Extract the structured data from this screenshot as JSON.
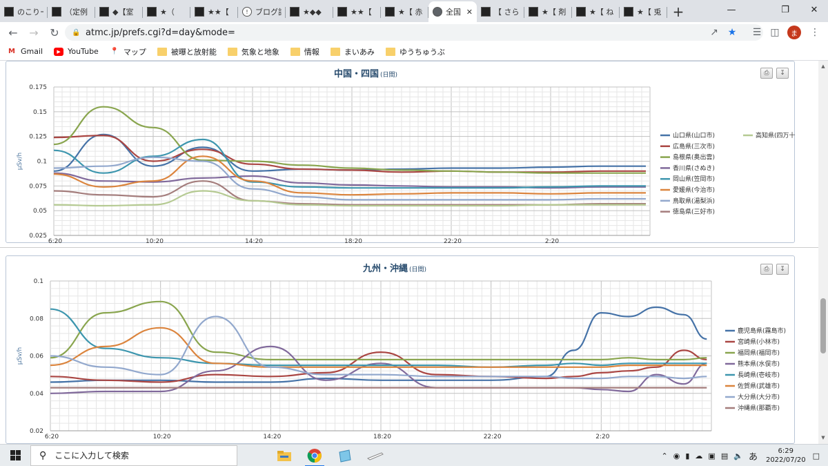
{
  "browser": {
    "tabs": [
      {
        "label": "のこりー",
        "icon": "site-icon",
        "active": false
      },
      {
        "label": "（定例",
        "icon": "site-icon",
        "active": false
      },
      {
        "label": "◆【室",
        "icon": "site-icon",
        "active": false
      },
      {
        "label": "★（",
        "icon": "site-icon",
        "active": false
      },
      {
        "label": "★★【",
        "icon": "site-icon",
        "active": false
      },
      {
        "label": "ブログ記",
        "icon": "blog-icon",
        "active": false
      },
      {
        "label": "★◆◆",
        "icon": "site-icon",
        "active": false
      },
      {
        "label": "★★【",
        "icon": "site-icon",
        "active": false
      },
      {
        "label": "★【 赤",
        "icon": "site-icon",
        "active": false
      },
      {
        "label": "全国",
        "icon": "globe-icon",
        "active": true
      },
      {
        "label": "【 さら",
        "icon": "site-icon",
        "active": false
      },
      {
        "label": "★【 剤",
        "icon": "site-icon",
        "active": false
      },
      {
        "label": "★【 ね",
        "icon": "site-icon",
        "active": false
      },
      {
        "label": "★【 兎",
        "icon": "site-icon",
        "active": false
      }
    ],
    "url": "atmc.jp/prefs.cgi?d=day&mode=",
    "avatar_initial": "ま",
    "bookmarks": [
      {
        "label": "Gmail",
        "icon": "gmail-icon"
      },
      {
        "label": "YouTube",
        "icon": "youtube-icon"
      },
      {
        "label": "マップ",
        "icon": "maps-icon"
      },
      {
        "label": "被曝と放射能",
        "icon": "folder-icon"
      },
      {
        "label": "気象と地象",
        "icon": "folder-icon"
      },
      {
        "label": "情報",
        "icon": "folder-icon"
      },
      {
        "label": "まいあみ",
        "icon": "folder-icon"
      },
      {
        "label": "ゆうちゅうぶ",
        "icon": "folder-icon"
      }
    ]
  },
  "taskbar": {
    "search_placeholder": "ここに入力して検索",
    "time": "6:29",
    "date": "2022/07/20",
    "ime": "あ"
  },
  "chart_data": [
    {
      "type": "line",
      "title": "中国・四国",
      "subtitle": "(日間)",
      "ylabel": "μSv/h",
      "ylim": [
        0.025,
        0.175
      ],
      "yticks": [
        "0.175",
        "0.15",
        "0.125",
        "0.1",
        "0.075",
        "0.05",
        "0.025"
      ],
      "xticks": [
        "6:20",
        "10:20",
        "14:20",
        "18:20",
        "22:20",
        "2:20"
      ],
      "x": [
        "6:20",
        "8:20",
        "10:20",
        "12:20",
        "14:20",
        "16:20",
        "18:20",
        "20:20",
        "22:20",
        "0:20",
        "2:20",
        "4:20",
        "6:10"
      ],
      "grid": true,
      "legend": "right",
      "series": [
        {
          "name": "山口県(山口市)",
          "color": "#4572a7",
          "values": [
            0.09,
            0.127,
            0.095,
            0.114,
            0.09,
            0.092,
            0.091,
            0.092,
            0.093,
            0.093,
            0.094,
            0.095,
            0.095
          ]
        },
        {
          "name": "広島県(三次市)",
          "color": "#aa4643",
          "values": [
            0.124,
            0.126,
            0.1,
            0.112,
            0.097,
            0.092,
            0.091,
            0.089,
            0.09,
            0.089,
            0.089,
            0.09,
            0.09
          ]
        },
        {
          "name": "島根県(奥出雲)",
          "color": "#89a54e",
          "values": [
            0.117,
            0.155,
            0.134,
            0.101,
            0.1,
            0.096,
            0.093,
            0.091,
            0.09,
            0.089,
            0.088,
            0.088,
            0.088
          ]
        },
        {
          "name": "香川県(さぬき)",
          "color": "#80699b",
          "values": [
            0.088,
            0.08,
            0.079,
            0.083,
            0.085,
            0.078,
            0.076,
            0.075,
            0.074,
            0.074,
            0.073,
            0.074,
            0.074
          ]
        },
        {
          "name": "岡山県(笠岡市)",
          "color": "#3d96ae",
          "values": [
            0.111,
            0.088,
            0.105,
            0.122,
            0.079,
            0.074,
            0.073,
            0.073,
            0.073,
            0.073,
            0.074,
            0.075,
            0.075
          ]
        },
        {
          "name": "愛媛県(今治市)",
          "color": "#db843d",
          "values": [
            0.087,
            0.074,
            0.08,
            0.105,
            0.08,
            0.068,
            0.066,
            0.067,
            0.068,
            0.068,
            0.067,
            0.068,
            0.068
          ]
        },
        {
          "name": "鳥取県(湯梨浜)",
          "color": "#92a8cd",
          "values": [
            0.093,
            0.095,
            0.104,
            0.1,
            0.072,
            0.064,
            0.061,
            0.061,
            0.061,
            0.061,
            0.061,
            0.062,
            0.062
          ]
        },
        {
          "name": "徳島県(三好市)",
          "color": "#a47d7c",
          "values": [
            0.07,
            0.066,
            0.064,
            0.08,
            0.06,
            0.057,
            0.056,
            0.056,
            0.056,
            0.056,
            0.056,
            0.057,
            0.057
          ]
        },
        {
          "name": "高知県(四万十)",
          "color": "#b5ca92",
          "values": [
            0.056,
            0.055,
            0.056,
            0.07,
            0.06,
            0.056,
            0.055,
            0.055,
            0.055,
            0.055,
            0.056,
            0.056,
            0.056
          ]
        }
      ]
    },
    {
      "type": "line",
      "title": "九州・沖縄",
      "subtitle": "(日間)",
      "ylabel": "μSv/h",
      "ylim": [
        0.02,
        0.1
      ],
      "yticks": [
        "0.1",
        "0.08",
        "0.06",
        "0.04",
        "0.02"
      ],
      "xticks": [
        "6:20",
        "10:20",
        "14:20",
        "18:20",
        "22:20",
        "2:20"
      ],
      "x": [
        "6:20",
        "8:20",
        "10:20",
        "12:20",
        "14:20",
        "16:20",
        "18:20",
        "20:20",
        "22:20",
        "0:20",
        "1:20",
        "2:20",
        "3:20",
        "4:20",
        "5:20",
        "6:10"
      ],
      "grid": true,
      "legend": "right",
      "series": [
        {
          "name": "鹿児島県(霧島市)",
          "color": "#4572a7",
          "values": [
            0.046,
            0.047,
            0.047,
            0.046,
            0.046,
            0.048,
            0.047,
            0.047,
            0.047,
            0.049,
            0.063,
            0.083,
            0.081,
            0.086,
            0.082,
            0.069
          ]
        },
        {
          "name": "宮崎県(小林市)",
          "color": "#aa4643",
          "values": [
            0.049,
            0.047,
            0.046,
            0.05,
            0.049,
            0.051,
            0.062,
            0.05,
            0.049,
            0.048,
            0.049,
            0.051,
            0.052,
            0.054,
            0.063,
            0.058
          ]
        },
        {
          "name": "福岡県(福岡市)",
          "color": "#89a54e",
          "values": [
            0.059,
            0.083,
            0.089,
            0.062,
            0.058,
            0.058,
            0.058,
            0.058,
            0.058,
            0.058,
            0.058,
            0.058,
            0.059,
            0.058,
            0.058,
            0.059
          ]
        },
        {
          "name": "熊本県(水俣市)",
          "color": "#80699b",
          "values": [
            0.04,
            0.041,
            0.041,
            0.052,
            0.065,
            0.047,
            0.056,
            0.043,
            0.043,
            0.043,
            0.043,
            0.042,
            0.041,
            0.05,
            0.045,
            0.056
          ]
        },
        {
          "name": "長崎県(壱岐市)",
          "color": "#3d96ae",
          "values": [
            0.085,
            0.064,
            0.059,
            0.056,
            0.055,
            0.055,
            0.055,
            0.055,
            0.054,
            0.055,
            0.056,
            0.055,
            0.056,
            0.056,
            0.056,
            0.056
          ]
        },
        {
          "name": "佐賀県(武雄市)",
          "color": "#db843d",
          "values": [
            0.055,
            0.065,
            0.075,
            0.056,
            0.054,
            0.054,
            0.054,
            0.054,
            0.054,
            0.054,
            0.054,
            0.054,
            0.055,
            0.055,
            0.055,
            0.055
          ]
        },
        {
          "name": "大分県(大分市)",
          "color": "#92a8cd",
          "values": [
            0.06,
            0.054,
            0.05,
            0.081,
            0.054,
            0.05,
            0.05,
            0.049,
            0.049,
            0.049,
            0.048,
            0.048,
            0.049,
            0.049,
            0.048,
            0.049
          ]
        },
        {
          "name": "沖縄県(那覇市)",
          "color": "#a47d7c",
          "values": [
            0.043,
            0.043,
            0.043,
            0.043,
            0.043,
            0.043,
            0.043,
            0.043,
            0.043,
            0.043,
            0.043,
            0.043,
            0.043,
            0.043,
            0.043,
            0.043
          ]
        }
      ]
    }
  ]
}
